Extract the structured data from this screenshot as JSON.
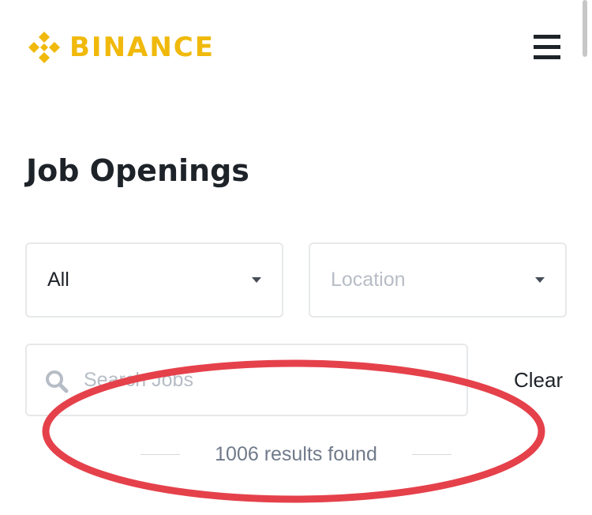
{
  "header": {
    "logo_text": "BINANCE",
    "logo_icon": "binance-diamond-logo",
    "menu_icon": "hamburger-menu-icon"
  },
  "page": {
    "title": "Job Openings"
  },
  "filters": {
    "category": {
      "value": "All",
      "icon": "caret-down-icon"
    },
    "location": {
      "placeholder": "Location",
      "icon": "caret-down-icon"
    }
  },
  "search": {
    "placeholder": "Search Jobs",
    "icon": "search-icon",
    "clear_label": "Clear"
  },
  "results": {
    "count_text": "1006 results found"
  },
  "colors": {
    "brand": "#f0b90b",
    "text_primary": "#1e2329",
    "text_muted": "#707a8a",
    "placeholder": "#b7bdc6",
    "border": "#e6e8ea",
    "annotation_red": "#e5414b"
  }
}
